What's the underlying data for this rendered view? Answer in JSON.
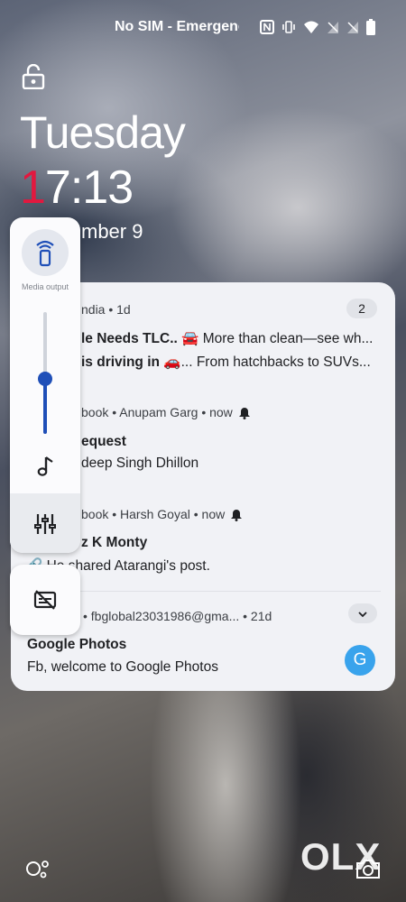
{
  "status_bar": {
    "carrier_text": "No SIM - Emergency calls only",
    "icons": [
      "nfc-icon",
      "vibrate-icon",
      "wifi-icon",
      "no-signal-icon",
      "no-signal-icon",
      "battery-icon"
    ]
  },
  "lockscreen": {
    "day": "Tuesday",
    "time_first_digit": "1",
    "time_rest": "7:13",
    "date_visible": "mber 9"
  },
  "notifications": [
    {
      "meta": "ndia • 1d",
      "count": "2",
      "title": "le Needs TLC.. 🚘",
      "title_rest": " More than clean—see wh...",
      "line2_bold": "is driving in 🚗",
      "line2_rest": "... From hatchbacks to SUVs..."
    },
    {
      "meta": "book • Anupam Garg • now",
      "title": "equest",
      "body": "deep Singh Dhillon"
    },
    {
      "meta": "book • Harsh Goyal • now",
      "title": "z K Monty",
      "body": "🔗 He shared Atarangi's post."
    },
    {
      "meta": "• fbglobal23031986@gma... • 21d",
      "title": "Google Photos",
      "body": "Fb, welcome to Google Photos",
      "avatar_letter": "G"
    }
  ],
  "volume_panel": {
    "output_label": "Media output",
    "level": 0.45
  },
  "watermark": "OLX",
  "colors": {
    "accent": "#1f4fb8",
    "time_highlight": "#e2183f",
    "avatar": "#39a3ec"
  }
}
